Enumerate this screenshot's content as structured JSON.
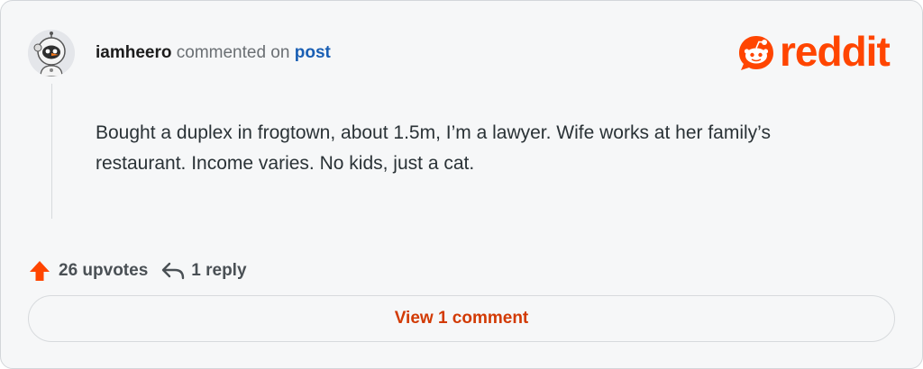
{
  "comment": {
    "username": "iamheero",
    "action_text": "commented on",
    "target_link": "post",
    "body": "Bought a duplex in frogtown, about 1.5m, I’m a lawyer. Wife works at her family’s restaurant. Income varies. No kids, just a cat."
  },
  "brand": {
    "logo_text": "reddit",
    "color": "#ff4500"
  },
  "stats": {
    "upvotes": "26 upvotes",
    "replies": "1 reply"
  },
  "view_button": {
    "label": "View 1 comment"
  },
  "icons": [
    "avatar",
    "reddit-snoo-icon",
    "upvote-icon",
    "reply-icon"
  ],
  "colors": {
    "accent_link": "#1a5fb4",
    "upvote": "#ff4500",
    "view_button_text": "#d23a04",
    "card_background": "#f6f7f8"
  }
}
